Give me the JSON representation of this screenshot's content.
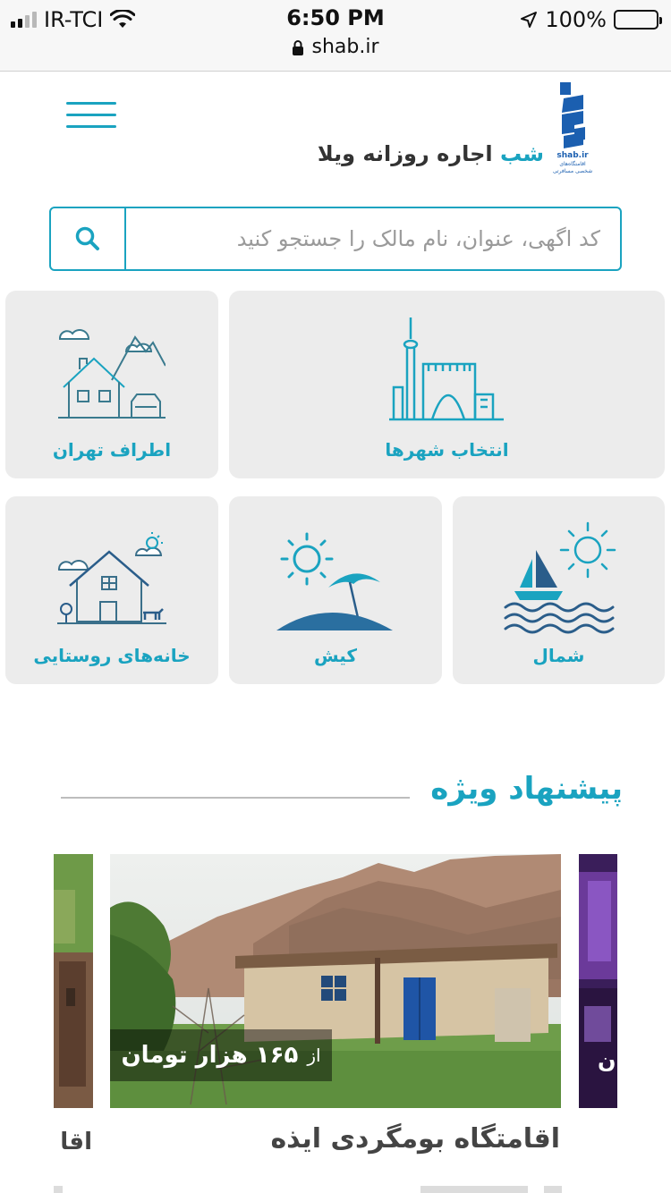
{
  "status_bar": {
    "carrier": "IR-TCI",
    "time": "6:50 PM",
    "battery": "100%",
    "url": "shab.ir"
  },
  "header": {
    "brand_accent": "شب",
    "brand_rest": "اجاره روزانه ویلا",
    "logo_domain": "shab.ir",
    "logo_caption_1": "اقامتگاه‌های",
    "logo_caption_2": "شخصی مسافرتی"
  },
  "search": {
    "placeholder": "کد اگهی، عنوان، نام مالک را جستجو کنید"
  },
  "categories": [
    {
      "label": "انتخاب شهرها",
      "icon": "city-icon"
    },
    {
      "label": "اطراف تهران",
      "icon": "house-mountains-icon"
    },
    {
      "label": "شمال",
      "icon": "sailboat-sun-icon"
    },
    {
      "label": "کیش",
      "icon": "island-umbrella-icon"
    },
    {
      "label": "خانه‌های روستایی",
      "icon": "rural-house-icon"
    }
  ],
  "featured": {
    "title": "پیشنهاد ویژه",
    "cards": [
      {
        "price_prefix": "از",
        "price": "۱۶۵ هزار تومان",
        "title": "اقامتگاه بومگردی ایذه"
      }
    ],
    "peek_left_title": "اقا",
    "peek_right_text": "ن"
  },
  "colors": {
    "accent": "#1aa3c0",
    "tile_bg": "#ececec",
    "logo_blue": "#1b5fb0"
  }
}
